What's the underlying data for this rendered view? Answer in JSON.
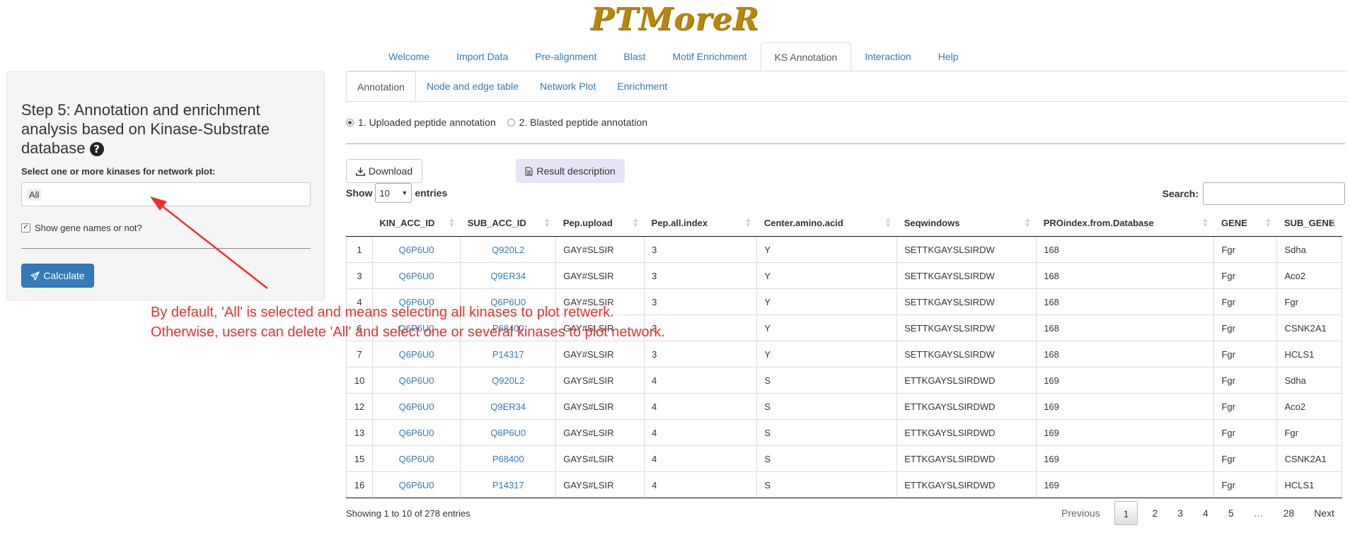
{
  "app": {
    "logo": "PTMoreR"
  },
  "topnav": {
    "tabs": [
      "Welcome",
      "Import Data",
      "Pre-alignment",
      "Blast",
      "Motif Enrichment",
      "KS Annotation",
      "Interaction",
      "Help"
    ],
    "active": "KS Annotation"
  },
  "sidebar": {
    "title": "Step 5: Annotation and enrichment analysis based on Kinase-Substrate database",
    "select_label": "Select one or more kinases for network plot:",
    "select_value": "All",
    "checkbox_label": "Show gene names or not?",
    "checkbox_checked": true,
    "calculate_label": "Calculate"
  },
  "subtabs": {
    "tabs": [
      "Annotation",
      "Node and edge table",
      "Network Plot",
      "Enrichment"
    ],
    "active": "Annotation"
  },
  "radios": {
    "options": [
      "1. Uploaded peptide annotation",
      "2. Blasted peptide annotation"
    ],
    "selected": 0
  },
  "buttons": {
    "download": "Download",
    "result_description": "Result description"
  },
  "table_controls": {
    "show_label": "Show",
    "entries_value": "10",
    "entries_label": "entries",
    "search_label": "Search:"
  },
  "table": {
    "headers": [
      "",
      "KIN_ACC_ID",
      "SUB_ACC_ID",
      "Pep.upload",
      "Pep.all.index",
      "Center.amino.acid",
      "Seqwindows",
      "PROindex.from.Database",
      "GENE",
      "SUB_GENE"
    ],
    "rows": [
      [
        "1",
        "Q6P6U0",
        "Q920L2",
        "GAY#SLSIR",
        "3",
        "Y",
        "SETTKGAYSLSIRDW",
        "168",
        "Fgr",
        "Sdha"
      ],
      [
        "3",
        "Q6P6U0",
        "Q9ER34",
        "GAY#SLSIR",
        "3",
        "Y",
        "SETTKGAYSLSIRDW",
        "168",
        "Fgr",
        "Aco2"
      ],
      [
        "4",
        "Q6P6U0",
        "Q6P6U0",
        "GAY#SLSIR",
        "3",
        "Y",
        "SETTKGAYSLSIRDW",
        "168",
        "Fgr",
        "Fgr"
      ],
      [
        "6",
        "Q6P6U0",
        "P68400",
        "GAY#SLSIR",
        "3",
        "Y",
        "SETTKGAYSLSIRDW",
        "168",
        "Fgr",
        "CSNK2A1"
      ],
      [
        "7",
        "Q6P6U0",
        "P14317",
        "GAY#SLSIR",
        "3",
        "Y",
        "SETTKGAYSLSIRDW",
        "168",
        "Fgr",
        "HCLS1"
      ],
      [
        "10",
        "Q6P6U0",
        "Q920L2",
        "GAYS#LSIR",
        "4",
        "S",
        "ETTKGAYSLSIRDWD",
        "169",
        "Fgr",
        "Sdha"
      ],
      [
        "12",
        "Q6P6U0",
        "Q9ER34",
        "GAYS#LSIR",
        "4",
        "S",
        "ETTKGAYSLSIRDWD",
        "169",
        "Fgr",
        "Aco2"
      ],
      [
        "13",
        "Q6P6U0",
        "Q6P6U0",
        "GAYS#LSIR",
        "4",
        "S",
        "ETTKGAYSLSIRDWD",
        "169",
        "Fgr",
        "Fgr"
      ],
      [
        "15",
        "Q6P6U0",
        "P68400",
        "GAYS#LSIR",
        "4",
        "S",
        "ETTKGAYSLSIRDWD",
        "169",
        "Fgr",
        "CSNK2A1"
      ],
      [
        "16",
        "Q6P6U0",
        "P14317",
        "GAYS#LSIR",
        "4",
        "S",
        "ETTKGAYSLSIRDWD",
        "169",
        "Fgr",
        "HCLS1"
      ]
    ]
  },
  "footer": {
    "info": "Showing 1 to 10 of 278 entries",
    "pagination": [
      "Previous",
      "1",
      "2",
      "3",
      "4",
      "5",
      "…",
      "28",
      "Next"
    ],
    "current_page": "1"
  },
  "annotation": {
    "line1": "By default, 'All' is selected and means selecting all kinases to plot retwerk.",
    "line2": "Otherwise, users can delete 'All' and select one or several kinases to plot network.",
    "color": "#ee2f2f"
  },
  "colors": {
    "accent": "#337ab7",
    "sidebar_bg": "#f5f5f5",
    "logo": "#b8860b"
  }
}
